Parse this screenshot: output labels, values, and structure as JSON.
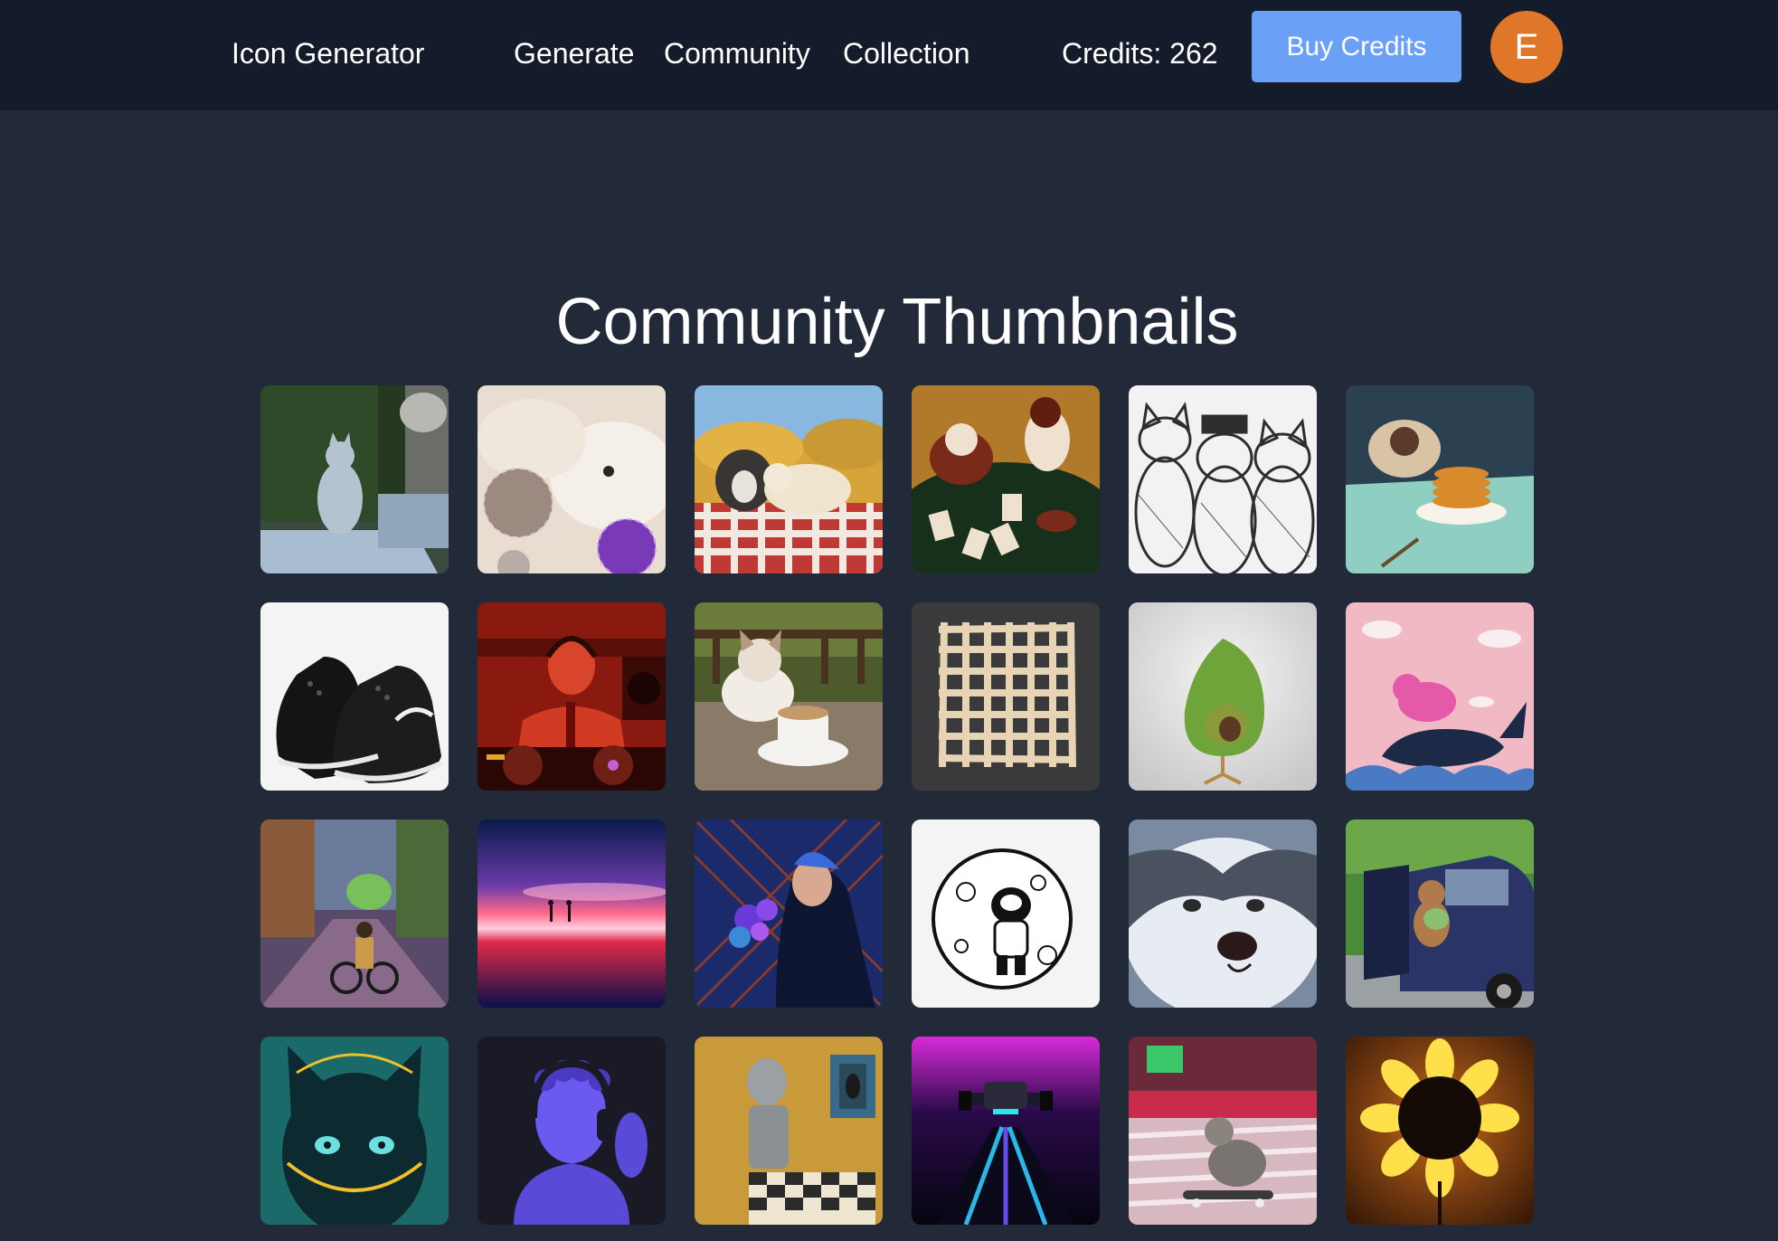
{
  "nav": {
    "brand": "Icon Generator",
    "links": [
      "Generate",
      "Community",
      "Collection"
    ],
    "credits_text": "Credits: 262",
    "buy_label": "Buy Credits",
    "avatar_initial": "E"
  },
  "colors": {
    "navbar_bg": "#141b2a",
    "page_bg": "#222a3a",
    "buy_button": "#6aa0f5",
    "avatar": "#e07627"
  },
  "main": {
    "title": "Community Thumbnails",
    "thumbnails": [
      {
        "subject": "cat-statue-icon"
      },
      {
        "subject": "cat-disco-balls-icon"
      },
      {
        "subject": "dogs-picnic-icon"
      },
      {
        "subject": "animals-playing-cards-icon"
      },
      {
        "subject": "sketched-cats-icon"
      },
      {
        "subject": "cat-pancakes-icon"
      },
      {
        "subject": "sneakers-icon"
      },
      {
        "subject": "dj-statue-icon"
      },
      {
        "subject": "cat-coffee-icon"
      },
      {
        "subject": "woven-lattice-icon"
      },
      {
        "subject": "avocado-chair-icon"
      },
      {
        "subject": "cat-riding-whale-icon"
      },
      {
        "subject": "cyclist-city-icon"
      },
      {
        "subject": "sunset-reflection-icon"
      },
      {
        "subject": "man-with-flowers-icon"
      },
      {
        "subject": "astronaut-moon-icon"
      },
      {
        "subject": "husky-icon"
      },
      {
        "subject": "teddy-bear-car-icon"
      },
      {
        "subject": "neon-cat-icon"
      },
      {
        "subject": "statue-headphones-icon"
      },
      {
        "subject": "robot-chess-icon"
      },
      {
        "subject": "race-car-icon"
      },
      {
        "subject": "cat-skateboard-icon"
      },
      {
        "subject": "sunflower-icon"
      }
    ]
  }
}
